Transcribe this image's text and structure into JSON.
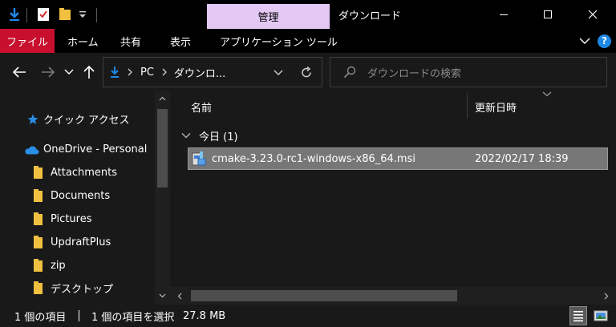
{
  "window": {
    "context_tab": "管理",
    "title": "ダウンロード",
    "icons": {
      "download": "download-arrow-icon",
      "properties": "properties-check-icon",
      "new_folder": "new-folder-icon",
      "customize": "customize-dropdown-icon",
      "minimize": "minimize-icon",
      "maximize": "maximize-icon",
      "close": "close-icon"
    }
  },
  "ribbon": {
    "tabs": [
      "ファイル",
      "ホーム",
      "共有",
      "表示",
      "アプリケーション ツール"
    ],
    "file_color": "#c8102e",
    "help_label": "?"
  },
  "address": {
    "crumbs": [
      "PC",
      "ダウンロ..."
    ],
    "search_placeholder": "ダウンロードの検索"
  },
  "nav": {
    "quick_access": "クイック アクセス",
    "onedrive": "OneDrive - Personal",
    "folders": [
      "Attachments",
      "Documents",
      "Pictures",
      "UpdraftPlus",
      "zip",
      "デスクトップ"
    ]
  },
  "columns": {
    "name": "名前",
    "date": "更新日時"
  },
  "group": {
    "label": "今日 (1)"
  },
  "files": [
    {
      "name": "cmake-3.23.0-rc1-windows-x86_64.msi",
      "date": "2022/02/17 18:39",
      "icon": "msi-installer-icon",
      "selected": true
    }
  ],
  "status": {
    "count": "1 個の項目",
    "selected": "1 個の項目を選択",
    "size": "27.8 MB"
  }
}
